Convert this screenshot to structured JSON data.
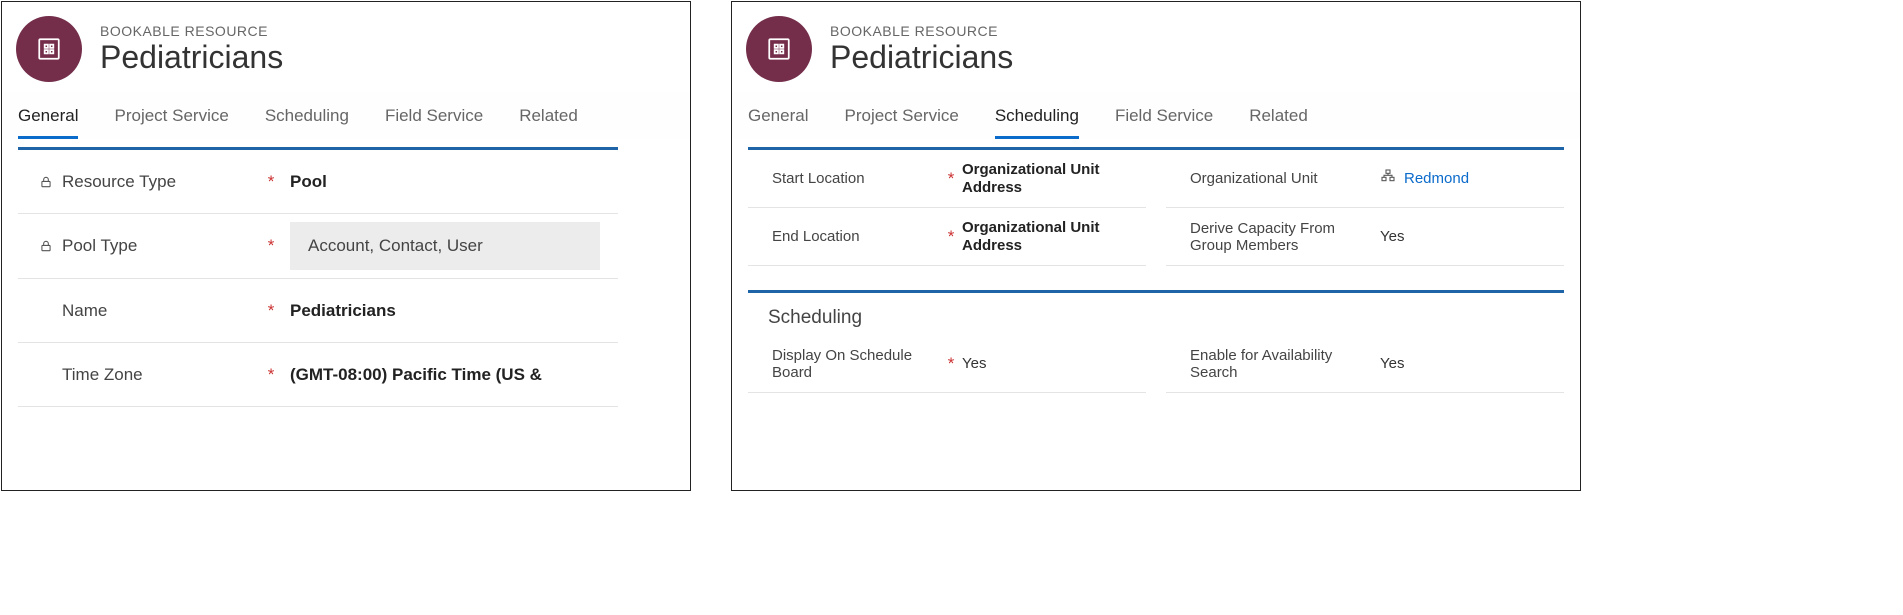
{
  "left": {
    "eyebrow": "BOOKABLE RESOURCE",
    "title": "Pediatricians",
    "tabs": [
      "General",
      "Project Service",
      "Scheduling",
      "Field Service",
      "Related"
    ],
    "activeTab": "General",
    "fields": {
      "resourceType": {
        "label": "Resource Type",
        "value": "Pool",
        "locked": true,
        "required": true
      },
      "poolType": {
        "label": "Pool Type",
        "value": "Account, Contact, User",
        "locked": true,
        "required": true,
        "boxed": true
      },
      "name": {
        "label": "Name",
        "value": "Pediatricians",
        "required": true
      },
      "timeZone": {
        "label": "Time Zone",
        "value": "(GMT-08:00) Pacific Time (US &",
        "required": true
      }
    }
  },
  "right": {
    "eyebrow": "BOOKABLE RESOURCE",
    "title": "Pediatricians",
    "tabs": [
      "General",
      "Project Service",
      "Scheduling",
      "Field Service",
      "Related"
    ],
    "activeTab": "Scheduling",
    "topGrid": {
      "startLocation": {
        "label": "Start Location",
        "value": "Organizational Unit Address",
        "required": true,
        "bold": true
      },
      "orgUnit": {
        "label": "Organizational Unit",
        "value": "Redmond",
        "lookup": true
      },
      "endLocation": {
        "label": "End Location",
        "value": "Organizational Unit Address",
        "required": true,
        "bold": true
      },
      "deriveCapacity": {
        "label": "Derive Capacity From Group Members",
        "value": "Yes"
      }
    },
    "section2": {
      "heading": "Scheduling",
      "displayOnBoard": {
        "label": "Display On Schedule Board",
        "value": "Yes",
        "required": true
      },
      "enableSearch": {
        "label": "Enable for Availability Search",
        "value": "Yes"
      }
    }
  }
}
